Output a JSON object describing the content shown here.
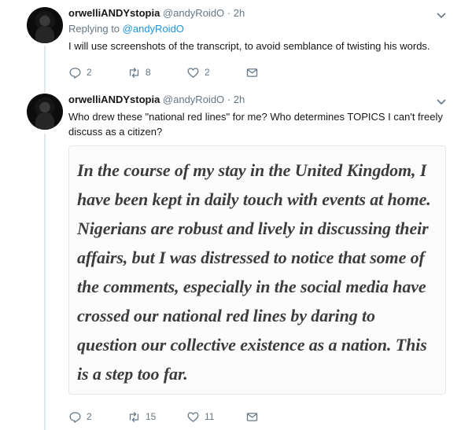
{
  "tweets": [
    {
      "name": "orwelliANDYstopia",
      "handle": "@andyRoidO",
      "separator": "·",
      "time": "2h",
      "replying_prefix": "Replying to",
      "replying_to": "@andyRoidO",
      "text": "I will use screenshots of the transcript, to avoid semblance of twisting his words.",
      "replies": "2",
      "retweets": "8",
      "likes": "2"
    },
    {
      "name": "orwelliANDYstopia",
      "handle": "@andyRoidO",
      "separator": "·",
      "time": "2h",
      "text": "Who drew these \"national red lines\" for me? Who determines TOPICS I can't freely discuss as a citizen?",
      "quote_image_text": "In the course of my stay in the United Kingdom, I have been kept in daily touch with events at home. Nigerians are robust and lively in discussing their affairs, but I was distressed to notice that some of the comments, especially in the social media have crossed our national red lines by daring to question our collective existence as a nation. This is a step too far.",
      "replies": "2",
      "retweets": "15",
      "likes": "11"
    }
  ],
  "colors": {
    "link": "#1b95e0",
    "muted": "#657786",
    "border": "#e1e8ed"
  },
  "icons": [
    "reply-icon",
    "retweet-icon",
    "like-icon",
    "direct-message-icon",
    "chevron-down-icon"
  ]
}
